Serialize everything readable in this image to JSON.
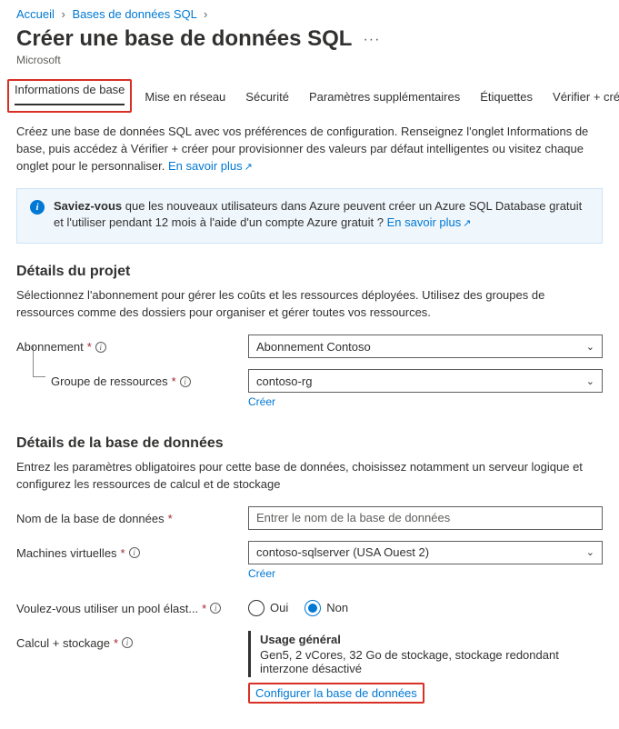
{
  "breadcrumb": {
    "home": "Accueil",
    "parent": "Bases de données SQL"
  },
  "header": {
    "title": "Créer une base de données SQL",
    "more": "···",
    "subtitle": "Microsoft"
  },
  "tabs": {
    "basics": "Informations de base",
    "networking": "Mise en réseau",
    "security": "Sécurité",
    "additional": "Paramètres supplémentaires",
    "tags": "Étiquettes",
    "review": "Vérifier + créer"
  },
  "intro": {
    "text": "Créez une base de données SQL avec vos préférences de configuration. Renseignez l'onglet Informations de base, puis accédez à Vérifier + créer pour provisionner des valeurs par défaut intelligentes ou visitez chaque onglet pour le personnaliser. ",
    "learn_more": "En savoir plus"
  },
  "infobox": {
    "bold": "Saviez-vous",
    "text": " que les nouveaux utilisateurs dans Azure peuvent créer un Azure SQL Database gratuit et l'utiliser pendant 12 mois à l'aide d'un compte Azure gratuit ? ",
    "link": "En savoir plus"
  },
  "project": {
    "heading": "Détails du projet",
    "desc": "Sélectionnez l'abonnement pour gérer les coûts et les ressources déployées. Utilisez des groupes de ressources comme des dossiers pour organiser et gérer toutes vos ressources.",
    "subscription_label": "Abonnement",
    "subscription_value": "Abonnement Contoso",
    "rg_label": "Groupe de ressources",
    "rg_value": "contoso-rg",
    "create_new": "Créer"
  },
  "database": {
    "heading": "Détails de la base de données",
    "desc": "Entrez les paramètres obligatoires pour cette base de données, choisissez notamment un serveur logique et configurez les ressources de calcul et de stockage",
    "name_label": "Nom de la base de données",
    "name_placeholder": "Entrer le nom de la base de données",
    "server_label": "Machines virtuelles",
    "server_value": "contoso-sqlserver (USA Ouest 2)",
    "create_new": "Créer",
    "pool_label": "Voulez-vous utiliser un pool élast...",
    "pool_yes": "Oui",
    "pool_no": "Non",
    "compute_label": "Calcul + stockage",
    "compute_tier": "Usage général",
    "compute_detail": "Gen5, 2 vCores, 32 Go de stockage, stockage redondant interzone désactivé",
    "configure_link": "Configurer la base de données"
  }
}
